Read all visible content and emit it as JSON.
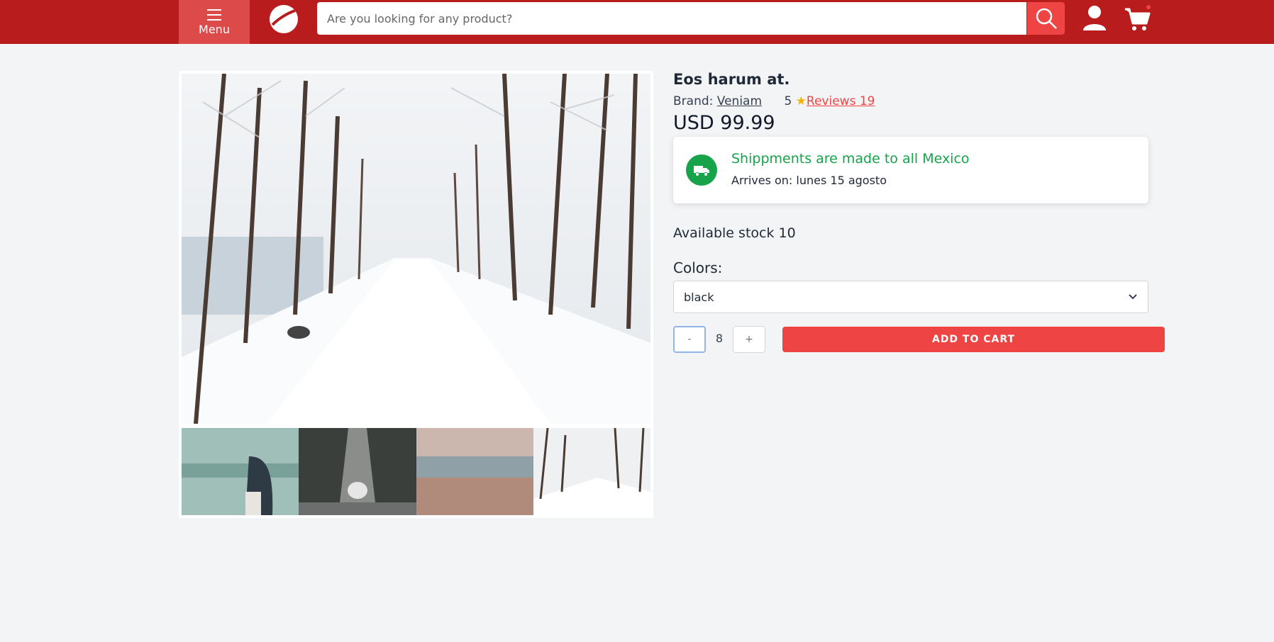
{
  "header": {
    "menu_label": "Menu",
    "search_placeholder": "Are you looking for any product?",
    "brand_color": "#b91c1c",
    "accent_color": "#ef4444"
  },
  "gallery": {
    "main_image": "snowy-road-with-trees",
    "thumbnails": [
      "person-by-lake",
      "snowy-forest-path",
      "lake-with-dry-grass",
      "snowy-road-with-trees"
    ]
  },
  "product": {
    "title": "Eos harum at.",
    "brand_label": "Brand:",
    "brand_name": "Veniam",
    "rating": "5",
    "reviews_link": "Reviews 19",
    "price": "USD 99.99",
    "shipping": {
      "title": "Shippments are made to all Mexico",
      "arrival": "Arrives on: lunes 15 agosto"
    },
    "stock": "Available stock 10",
    "colors_label": "Colors:",
    "selected_color": "black",
    "quantity": "8",
    "minus_label": "-",
    "plus_label": "+",
    "add_to_cart": "ADD TO CART"
  }
}
